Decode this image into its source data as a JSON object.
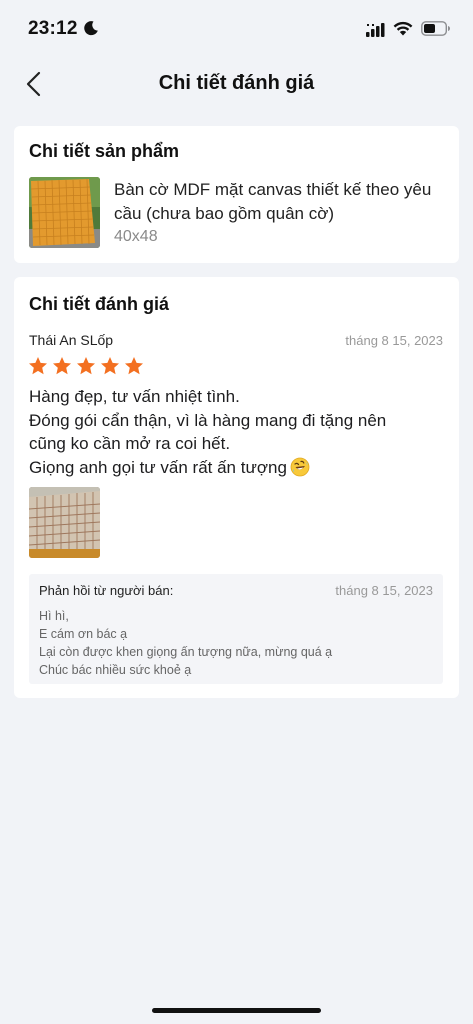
{
  "status_bar": {
    "time": "23:12"
  },
  "nav": {
    "title": "Chi tiết đánh giá"
  },
  "product": {
    "heading": "Chi tiết sản phẩm",
    "name": "Bàn cờ MDF mặt canvas thiết kế theo yêu cầu (chưa bao gồm quân cờ)",
    "variant": "40x48"
  },
  "review": {
    "heading": "Chi tiết đánh giá",
    "reviewer": "Thái An SLốp",
    "date": "tháng 8 15, 2023",
    "rating": 5,
    "rating_max": 5,
    "star_color": "#f37021",
    "lines": [
      "Hàng đẹp, tư vấn nhiệt tình.",
      "Đóng gói cẩn thận, vì là hàng mang đi tặng nên",
      "cũng ko cần mở ra coi hết.",
      "Giọng anh gọi tư vấn rất ấn tượng"
    ],
    "emoji": "rolling-on-floor-laughing-emoji"
  },
  "seller_reply": {
    "label": "Phản hồi từ người bán:",
    "date": "tháng 8 15, 2023",
    "lines": [
      "Hì hì,",
      "E cám ơn bác ạ",
      "Lại còn được khen giọng ấn tượng nữa, mừng quá ạ",
      "Chúc bác nhiều sức khoẻ ạ"
    ]
  },
  "icons": {
    "back": "back-arrow-icon",
    "moon": "moon-icon",
    "signal": "signal-icon",
    "wifi": "wifi-icon",
    "battery": "battery-icon"
  }
}
